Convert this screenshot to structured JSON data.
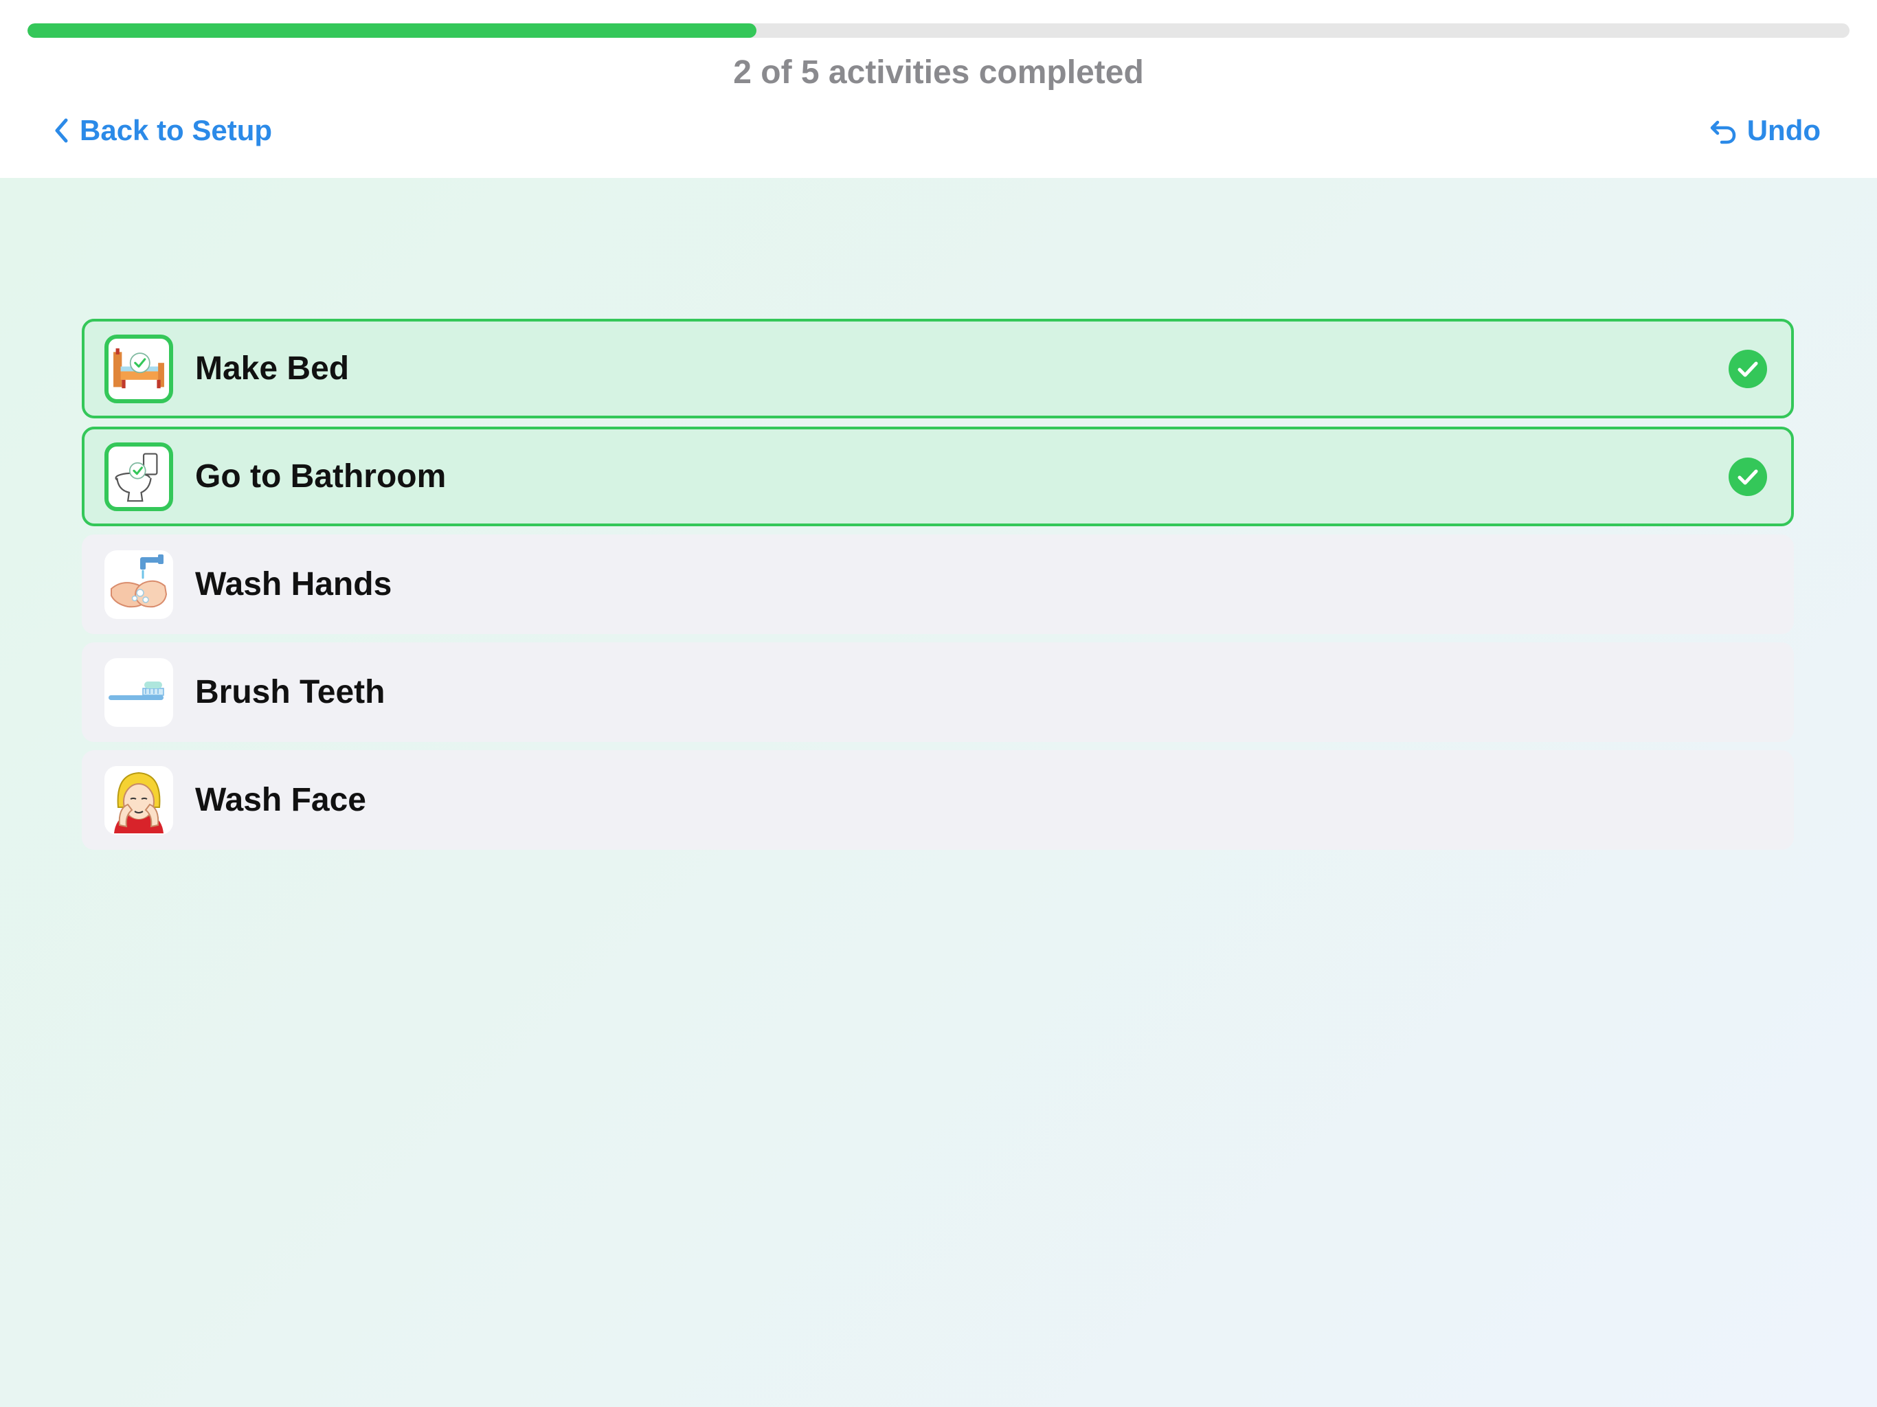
{
  "progress": {
    "completed": 2,
    "total": 5,
    "fraction": 0.4,
    "text": "2 of 5 activities completed",
    "fill_color": "#34c759",
    "track_color": "#e6e6e6"
  },
  "nav": {
    "back_label": "Back to Setup",
    "back_icon": "chevron-left-icon",
    "undo_label": "Undo",
    "undo_icon": "undo-arrow-icon",
    "accent_color": "#2b8ae8"
  },
  "activities": [
    {
      "label": "Make Bed",
      "completed": true,
      "icon": "bed-icon"
    },
    {
      "label": "Go to Bathroom",
      "completed": true,
      "icon": "toilet-icon"
    },
    {
      "label": "Wash Hands",
      "completed": false,
      "icon": "hand-washing-icon"
    },
    {
      "label": "Brush Teeth",
      "completed": false,
      "icon": "toothbrush-icon"
    },
    {
      "label": "Wash Face",
      "completed": false,
      "icon": "washing-face-icon"
    }
  ],
  "colors": {
    "completed_border": "#34c759",
    "completed_background": "#d6f3e3",
    "pending_background": "#f1f1f5"
  }
}
